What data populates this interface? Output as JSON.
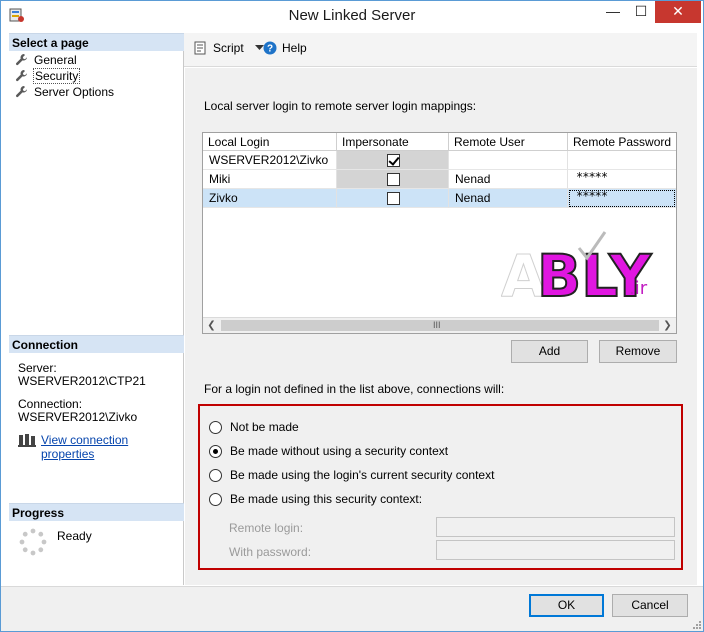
{
  "window": {
    "title": "New Linked Server",
    "minimize_glyph": "—",
    "maximize_glyph": "☐",
    "close_glyph": "✕"
  },
  "left_pane": {
    "select_page_header": "Select a page",
    "pages": [
      {
        "label": "General",
        "icon": "wrench-icon"
      },
      {
        "label": "Security",
        "icon": "wrench-icon"
      },
      {
        "label": "Server Options",
        "icon": "wrench-icon"
      }
    ],
    "connection_header": "Connection",
    "server_label": "Server:",
    "server_value": "WSERVER2012\\CTP21",
    "connection_label": "Connection:",
    "connection_value": "WSERVER2012\\Zivko",
    "view_connection_link": "View connection properties",
    "progress_header": "Progress",
    "progress_status": "Ready"
  },
  "toolbar": {
    "script_label": "Script",
    "help_label": "Help"
  },
  "security": {
    "mappings_label": "Local server login to remote server login mappings:",
    "columns": [
      "Local Login",
      "Impersonate",
      "Remote User",
      "Remote Password"
    ],
    "rows": [
      {
        "local_login": "WSERVER2012\\Zivko",
        "impersonate": true,
        "remote_user": "",
        "remote_password": ""
      },
      {
        "local_login": "Miki",
        "impersonate": false,
        "remote_user": "Nenad",
        "remote_password": "*****"
      },
      {
        "local_login": "Zivko",
        "impersonate": false,
        "remote_user": "Nenad",
        "remote_password": "*****"
      }
    ],
    "selected_row_index": 2,
    "scroll_grip": "III",
    "add_button": "Add",
    "remove_button": "Remove",
    "undefined_login_label": "For a login not defined in the list above, connections will:",
    "options": [
      {
        "label": "Not be made",
        "selected": false
      },
      {
        "label": "Be made without using a security context",
        "selected": true
      },
      {
        "label": "Be made using the login's current security context",
        "selected": false
      },
      {
        "label": "Be made using this security context:",
        "selected": false
      }
    ],
    "remote_login_label": "Remote login:",
    "remote_login_value": "",
    "with_password_label": "With password:",
    "with_password_value": ""
  },
  "watermark": {
    "brand": "ABLY",
    "suffix": ".ir",
    "brand_color": "#e016e0",
    "suffix_color": "#c21ec2"
  },
  "footer": {
    "ok_button": "OK",
    "cancel_button": "Cancel"
  },
  "colors": {
    "accent": "#0078d7",
    "highlight_box": "#c00000",
    "selected_row": "#cce3f7",
    "section_header": "#d6e4f4"
  }
}
